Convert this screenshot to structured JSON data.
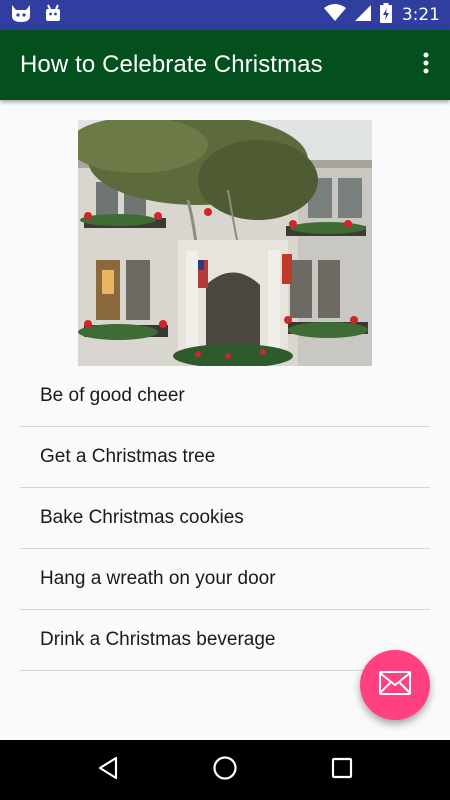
{
  "status_bar": {
    "time": "3:21",
    "icons": [
      "cat-notification-icon",
      "android-notification-icon",
      "wifi-icon",
      "cellular-signal-icon",
      "battery-charging-icon"
    ]
  },
  "app_bar": {
    "title": "How to Celebrate Christmas",
    "overflow_icon": "more-vert-icon"
  },
  "hero": {
    "subject": "Victorian house decorated for Christmas"
  },
  "list": {
    "items": [
      "Be of good cheer",
      "Get a Christmas tree",
      "Bake Christmas cookies",
      "Hang a wreath on your door",
      "Drink a Christmas beverage"
    ]
  },
  "fab": {
    "icon": "email-icon"
  },
  "nav_bar": {
    "icons": [
      "back-icon",
      "home-icon",
      "recents-icon"
    ]
  },
  "colors": {
    "status_bar": "#303f9f",
    "app_bar": "#03501e",
    "fab": "#ff4081",
    "background": "#fafafa"
  }
}
